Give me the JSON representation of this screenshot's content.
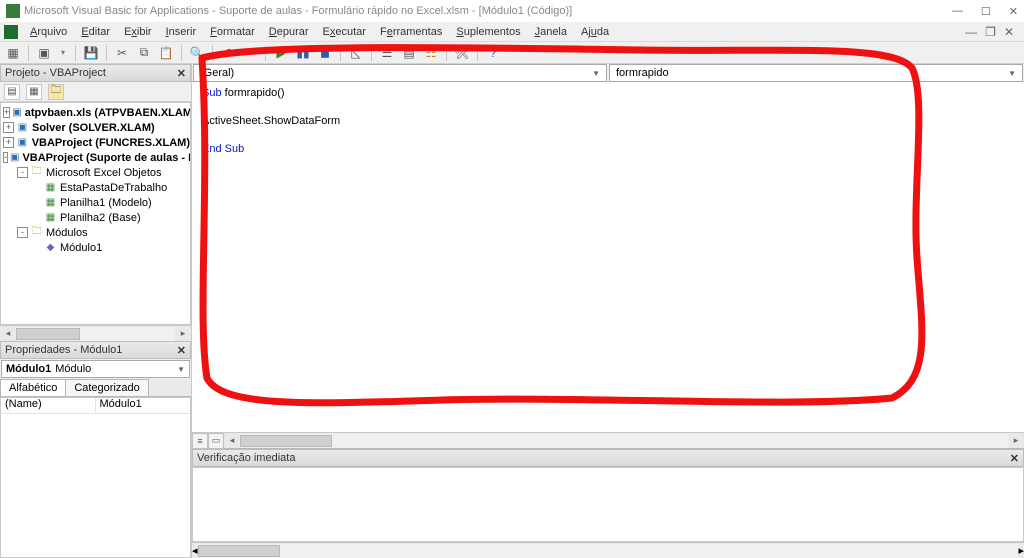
{
  "titlebar": {
    "text": "Microsoft Visual Basic for Applications - Suporte de aulas - Formulário rápido no Excel.xlsm - [Módulo1 (Código)]"
  },
  "menu": {
    "items": [
      "Arquivo",
      "Editar",
      "Exibir",
      "Inserir",
      "Formatar",
      "Depurar",
      "Executar",
      "Ferramentas",
      "Suplementos",
      "Janela",
      "Ajuda"
    ],
    "accel": [
      "A",
      "E",
      "x",
      "I",
      "F",
      "D",
      "x",
      "e",
      "S",
      "J",
      "u"
    ]
  },
  "project_panel": {
    "title": "Projeto - VBAProject",
    "nodes": [
      {
        "depth": 0,
        "expander": "+",
        "icon": "book",
        "bold": true,
        "label": "atpvbaen.xls (ATPVBAEN.XLAM)"
      },
      {
        "depth": 0,
        "expander": "+",
        "icon": "book",
        "bold": true,
        "label": "Solver (SOLVER.XLAM)"
      },
      {
        "depth": 0,
        "expander": "+",
        "icon": "book",
        "bold": true,
        "label": "VBAProject (FUNCRES.XLAM)"
      },
      {
        "depth": 0,
        "expander": "-",
        "icon": "book",
        "bold": true,
        "label": "VBAProject (Suporte de aulas - Formulário rápid"
      },
      {
        "depth": 1,
        "expander": "-",
        "icon": "folder",
        "bold": false,
        "label": "Microsoft Excel Objetos"
      },
      {
        "depth": 2,
        "expander": "",
        "icon": "sheet",
        "bold": false,
        "label": "EstaPastaDeTrabalho"
      },
      {
        "depth": 2,
        "expander": "",
        "icon": "sheet",
        "bold": false,
        "label": "Planilha1 (Modelo)"
      },
      {
        "depth": 2,
        "expander": "",
        "icon": "sheet",
        "bold": false,
        "label": "Planilha2 (Base)"
      },
      {
        "depth": 1,
        "expander": "-",
        "icon": "folder",
        "bold": false,
        "label": "Módulos"
      },
      {
        "depth": 2,
        "expander": "",
        "icon": "mod",
        "bold": false,
        "label": "Módulo1"
      }
    ]
  },
  "properties_panel": {
    "title": "Propriedades - Módulo1",
    "combo_name": "Módulo1",
    "combo_type": "Módulo",
    "tabs": {
      "alpha": "Alfabético",
      "cat": "Categorizado"
    },
    "rows": [
      {
        "k": "(Name)",
        "v": "Módulo1"
      }
    ]
  },
  "code_panel": {
    "object_combo": "(Geral)",
    "proc_combo": "formrapido",
    "lines": [
      {
        "t": "kw",
        "s": "Sub "
      },
      {
        "t": "tx",
        "s": "formrapido()"
      },
      {
        "t": "br"
      },
      {
        "t": "br"
      },
      {
        "t": "tx",
        "s": "ActiveSheet.ShowDataForm"
      },
      {
        "t": "br"
      },
      {
        "t": "br"
      },
      {
        "t": "kw",
        "s": "End Sub"
      }
    ]
  },
  "immediate_panel": {
    "title": "Verificação imediata"
  }
}
